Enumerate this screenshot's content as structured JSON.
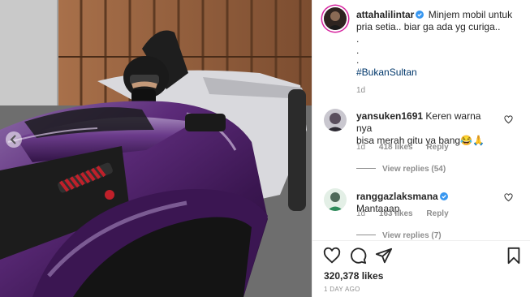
{
  "post": {
    "author": "attahalilintar",
    "caption_line1": "Minjem mobil untuk",
    "caption_line2": "pria setia.. biar ga ada yg curiga..",
    "caption_dots": [
      ".",
      ".",
      "."
    ],
    "hashtag": "#BukanSultan",
    "age": "1d"
  },
  "comments": [
    {
      "username": "yansuken1691",
      "text_line1": "Keren warna nya",
      "text_line2": "bisa merah gitu ya bang😂🙏",
      "age": "1d",
      "likes": "418 likes",
      "reply_label": "Reply",
      "view_replies": "View replies (54)",
      "verified": false
    },
    {
      "username": "ranggazlaksmana",
      "text_line1": "Mantaaap",
      "age": "1d",
      "likes": "163 likes",
      "reply_label": "Reply",
      "view_replies": "View replies (7)",
      "verified": true
    }
  ],
  "footer": {
    "like_count": "320,378 likes",
    "post_age": "1 DAY AGO"
  },
  "icons": {
    "verified": "verified-badge-icon",
    "heart": "heart-icon",
    "comment": "comment-icon",
    "share": "share-icon",
    "save": "bookmark-icon"
  },
  "colors": {
    "verified_blue": "#3897f0",
    "hashtag": "#00376b",
    "secondary_text": "#8e8e8e",
    "car_purple": "#5b2a78"
  }
}
